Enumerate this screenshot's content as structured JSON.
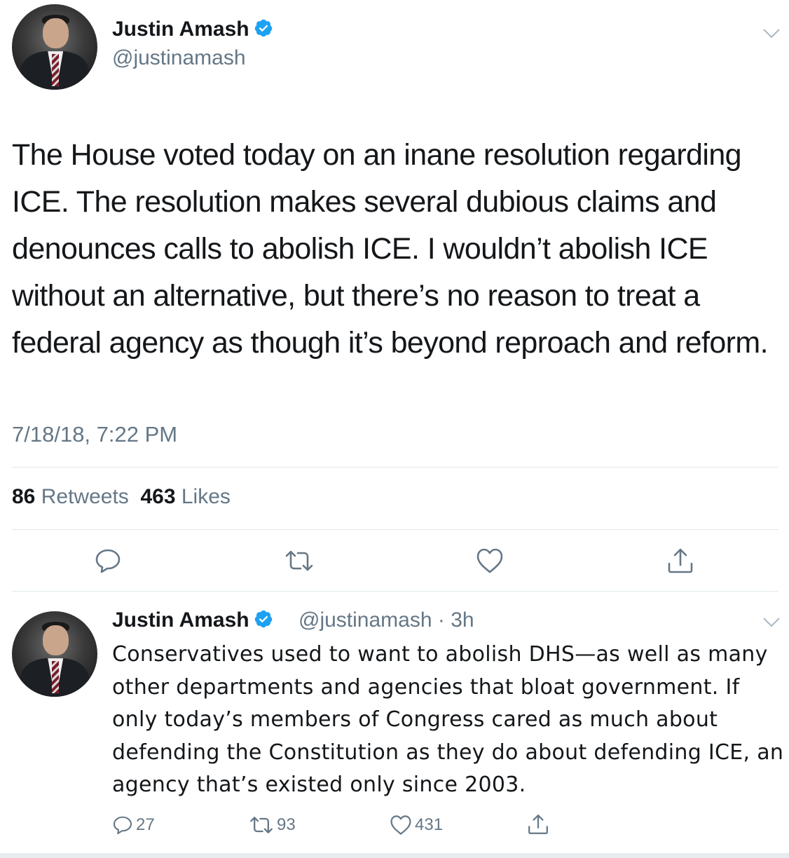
{
  "main_tweet": {
    "author_name": "Justin Amash",
    "handle": "@justinamash",
    "text": "The House voted today on an inane resolution regarding ICE. The resolution makes several dubious claims and denounces calls to abolish ICE. I wouldn’t abolish ICE without an alternative, but there’s no reason to treat a federal agency as though it’s beyond reproach and reform.",
    "timestamp": "7/18/18, 7:22 PM",
    "retweets_count": "86",
    "retweets_label": "Retweets",
    "likes_count": "463",
    "likes_label": "Likes"
  },
  "reply_tweet": {
    "author_name": "Justin Amash",
    "handle_time": "@justinamash · 3h",
    "text": "Conservatives used to want to abolish DHS—as well as many other departments and agencies that bloat government. If only today’s members of Congress cared as much about defending the Constitution as they do about defending ICE, an agency that’s existed only since 2003.",
    "reply_count": "27",
    "retweet_count": "93",
    "like_count": "431"
  },
  "icons": {
    "verified": "verified-badge-icon",
    "chevron": "chevron-down-icon",
    "reply": "reply-icon",
    "retweet": "retweet-icon",
    "like": "heart-icon",
    "share": "share-icon"
  },
  "colors": {
    "verified_blue": "#1da1f2",
    "secondary_text": "#657786",
    "divider": "#e1e8ed"
  }
}
